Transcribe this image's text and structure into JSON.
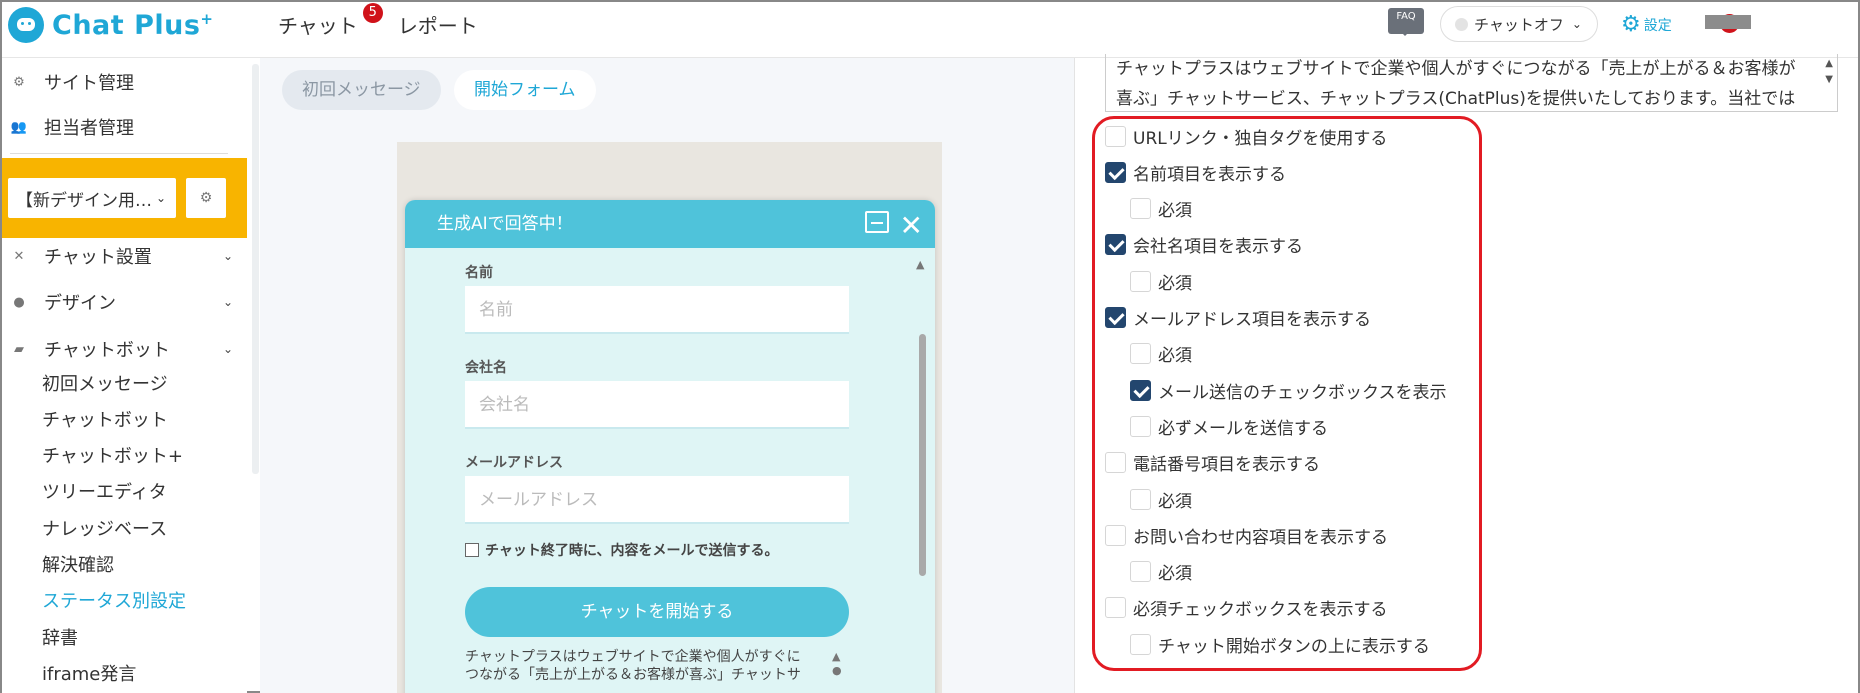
{
  "header": {
    "logo_text": "Chat Plus",
    "logo_plus": "+",
    "nav": [
      {
        "label": "チャット",
        "badge": "5"
      },
      {
        "label": "レポート"
      }
    ],
    "faq_label": "FAQ",
    "status_label": "チャットオフ",
    "settings_label": "設定",
    "alert_label": "!"
  },
  "sidebar": {
    "items_top": [
      {
        "label": "サイト管理",
        "icon": "gear-icon"
      },
      {
        "label": "担当者管理",
        "icon": "users-icon"
      }
    ],
    "project_select": "【新デザイン用…",
    "sections": [
      {
        "label": "チャット設置",
        "icon": "tools-icon"
      },
      {
        "label": "デザイン",
        "icon": "palette-icon"
      },
      {
        "label": "チャットボット",
        "icon": "chat-icon"
      }
    ],
    "sub_items": [
      "初回メッセージ",
      "チャットボット",
      "チャットボット+",
      "ツリーエディタ",
      "ナレッジベース",
      "解決確認",
      "ステータス別設定",
      "辞書",
      "iframe発言"
    ],
    "active_sub": "ステータス別設定"
  },
  "tabs": {
    "initial": "初回メッセージ",
    "form": "開始フォーム"
  },
  "widget": {
    "title": "生成AIで回答中！",
    "fields": [
      {
        "label": "名前",
        "placeholder": "名前"
      },
      {
        "label": "会社名",
        "placeholder": "会社名"
      },
      {
        "label": "メールアドレス",
        "placeholder": "メールアドレス"
      }
    ],
    "email_check_label": "チャット終了時に、内容をメールで送信する。",
    "start_button": "チャットを開始する",
    "description_lines": [
      "チャットプラスはウェブサイトで企業や個人がすぐに",
      "つながる「売上が上がる＆お客様が喜ぶ」チャットサ"
    ]
  },
  "right_panel": {
    "textarea_lines": [
      "チャットプラスはウェブサイトで企業や個人がすぐにつながる「売上が上がる＆お客様が",
      "喜ぶ」チャットサービス、チャットプラス(ChatPlus)を提供いたしております。当社では"
    ],
    "options": [
      {
        "label": "URLリンク・独自タグを使用する",
        "checked": false,
        "indent": 0
      },
      {
        "label": "名前項目を表示する",
        "checked": true,
        "indent": 0
      },
      {
        "label": "必須",
        "checked": false,
        "indent": 1
      },
      {
        "label": "会社名項目を表示する",
        "checked": true,
        "indent": 0
      },
      {
        "label": "必須",
        "checked": false,
        "indent": 1
      },
      {
        "label": "メールアドレス項目を表示する",
        "checked": true,
        "indent": 0
      },
      {
        "label": "必須",
        "checked": false,
        "indent": 1
      },
      {
        "label": "メール送信のチェックボックスを表示",
        "checked": true,
        "indent": 1
      },
      {
        "label": "必ずメールを送信する",
        "checked": false,
        "indent": 1
      },
      {
        "label": "電話番号項目を表示する",
        "checked": false,
        "indent": 0
      },
      {
        "label": "必須",
        "checked": false,
        "indent": 1
      },
      {
        "label": "お問い合わせ内容項目を表示する",
        "checked": false,
        "indent": 0
      },
      {
        "label": "必須",
        "checked": false,
        "indent": 1
      },
      {
        "label": "必須チェックボックスを表示する",
        "checked": false,
        "indent": 0
      },
      {
        "label": "チャット開始ボタンの上に表示する",
        "checked": false,
        "indent": 1
      }
    ]
  }
}
